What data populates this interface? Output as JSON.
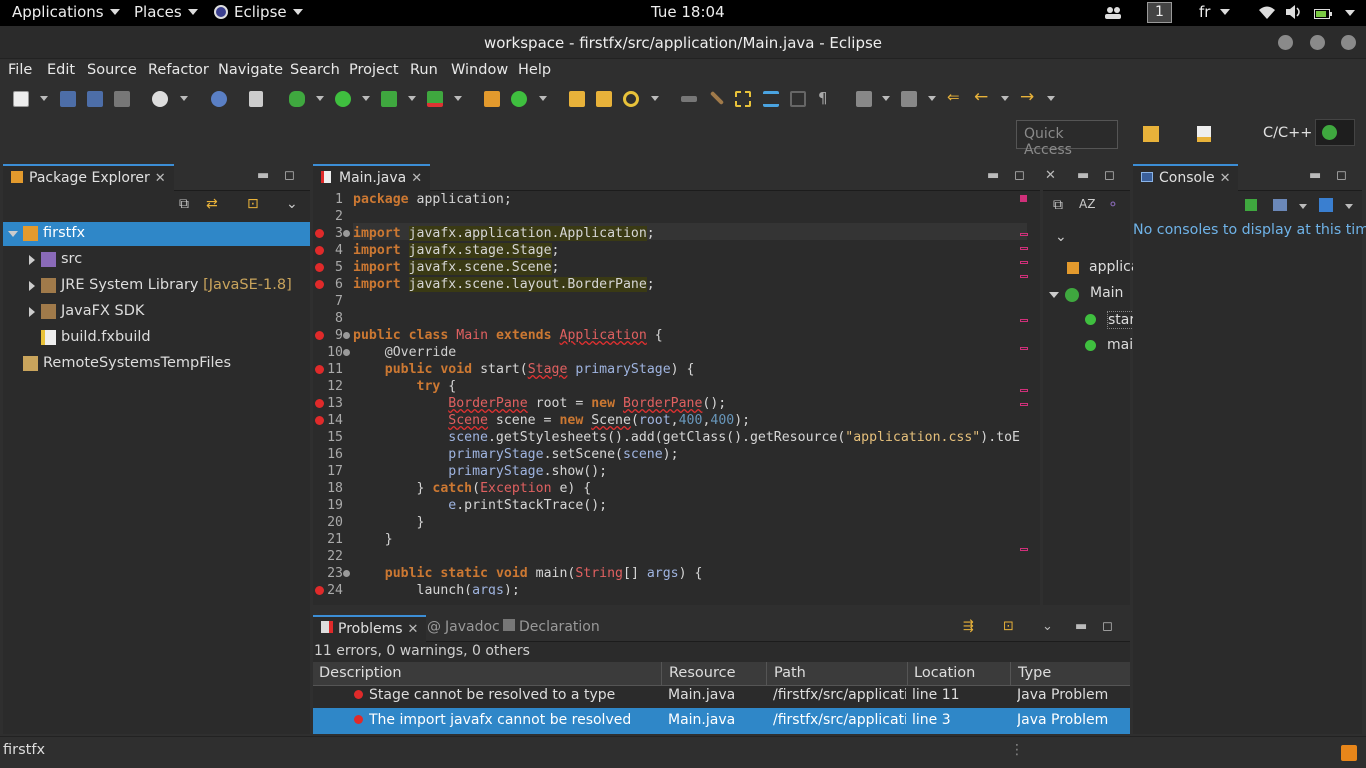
{
  "topbar": {
    "applications": "Applications",
    "places": "Places",
    "app_name": "Eclipse",
    "clock": "Tue 18:04",
    "workspace_badge": "1",
    "keyboard_layout": "fr"
  },
  "window": {
    "title": "workspace - firstfx/src/application/Main.java - Eclipse"
  },
  "menu": {
    "items": [
      "File",
      "Edit",
      "Source",
      "Refactor",
      "Navigate",
      "Search",
      "Project",
      "Run",
      "Window",
      "Help"
    ]
  },
  "toolbar": {
    "quick_access_placeholder": "Quick Access",
    "perspective_label": "C/C++"
  },
  "package_explorer": {
    "tab_label": "Package Explorer",
    "tree": [
      {
        "label": "firstfx",
        "suffix": "",
        "selected": true
      },
      {
        "label": "src",
        "suffix": ""
      },
      {
        "label": "JRE System Library",
        "suffix": "[JavaSE-1.8]"
      },
      {
        "label": "JavaFX SDK",
        "suffix": ""
      },
      {
        "label": "build.fxbuild",
        "suffix": ""
      },
      {
        "label": "RemoteSystemsTempFiles",
        "suffix": ""
      }
    ]
  },
  "editor": {
    "tab_label": "Main.java",
    "line_numbers": [
      "1",
      "2",
      "3",
      "4",
      "5",
      "6",
      "7",
      "8",
      "9",
      "10",
      "11",
      "12",
      "13",
      "14",
      "15",
      "16",
      "17",
      "18",
      "19",
      "20",
      "21",
      "22",
      "23",
      "24"
    ]
  },
  "outline": {
    "items": [
      "applica",
      "Main",
      "star",
      "mai"
    ]
  },
  "console": {
    "tab_label": "Console",
    "message": "No consoles to display at this time."
  },
  "problems": {
    "tab_label": "Problems",
    "javadoc_label": "Javadoc",
    "declaration_label": "Declaration",
    "summary": "11 errors, 0 warnings, 0 others",
    "columns": [
      "Description",
      "Resource",
      "Path",
      "Location",
      "Type"
    ],
    "rows": [
      {
        "description": "Stage cannot be resolved to a type",
        "resource": "Main.java",
        "path": "/firstfx/src/application",
        "location": "line 11",
        "type": "Java Problem"
      },
      {
        "description": "The import javafx cannot be resolved",
        "resource": "Main.java",
        "path": "/firstfx/src/application",
        "location": "line 3",
        "type": "Java Problem"
      }
    ]
  },
  "status": {
    "text": "firstfx"
  },
  "colors": {
    "selection": "#2f87c8",
    "error": "#e02a2a",
    "keyword": "#cc7832"
  }
}
